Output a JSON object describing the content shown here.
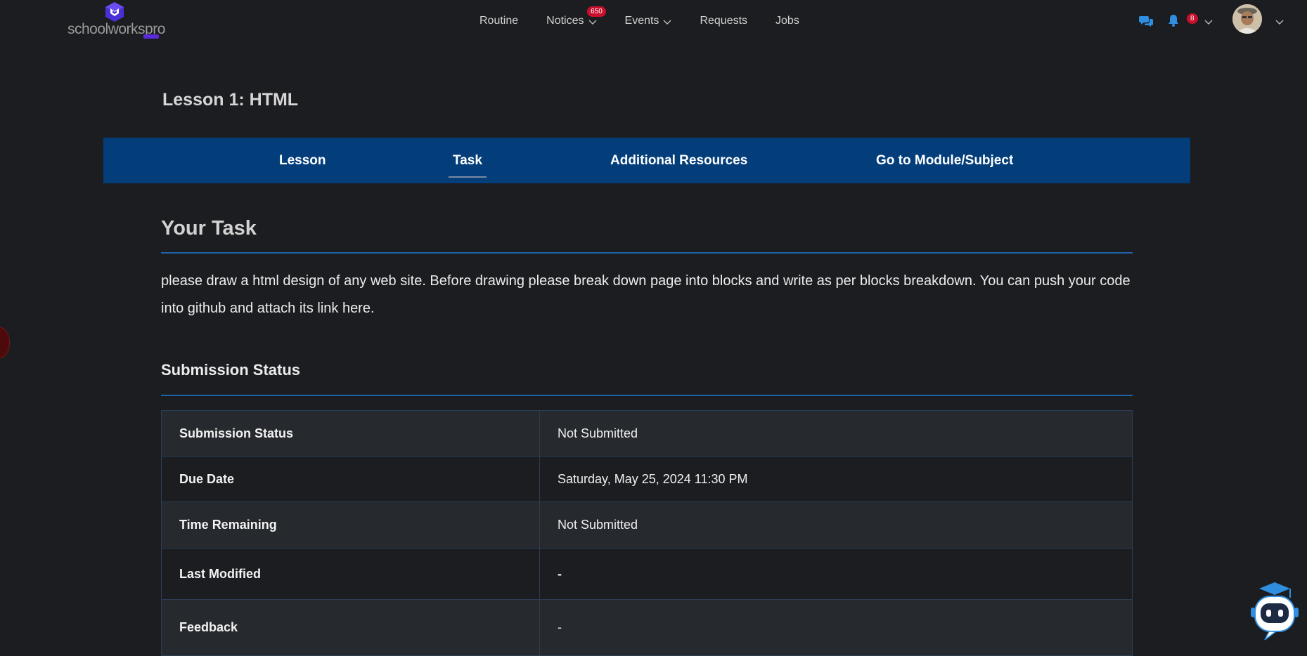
{
  "brand": {
    "name": "schoolworkspro",
    "logo_icon": "cube-logo-icon"
  },
  "nav": {
    "routine": "Routine",
    "notices": "Notices",
    "notices_badge": "650",
    "events": "Events",
    "requests": "Requests",
    "jobs": "Jobs"
  },
  "header_right": {
    "chat_icon": "chat-icon",
    "bell_icon": "bell-icon",
    "bell_badge": "8",
    "avatar": "user-avatar"
  },
  "lesson": {
    "title": "Lesson 1: HTML"
  },
  "tabs": [
    {
      "label": "Lesson",
      "active": false
    },
    {
      "label": "Task",
      "active": true
    },
    {
      "label": "Additional Resources",
      "active": false
    },
    {
      "label": "Go to Module/Subject",
      "active": false
    }
  ],
  "task": {
    "heading": "Your Task",
    "description": "please draw a html design of any web site. Before drawing please break down page into blocks and write as per blocks breakdown. You can push your code into github and attach its link here."
  },
  "submission": {
    "heading": "Submission Status",
    "rows": [
      {
        "label": "Submission Status",
        "value": "Not Submitted"
      },
      {
        "label": "Due Date",
        "value": "Saturday, May 25, 2024 11:30 PM"
      },
      {
        "label": "Time Remaining",
        "value": "Not Submitted"
      },
      {
        "label": "Last Modified",
        "value": "-"
      },
      {
        "label": "Feedback",
        "value": "-"
      }
    ]
  },
  "colors": {
    "background": "#1b1d20",
    "tabbar": "#033e7a",
    "accent_rule": "#1e63a8",
    "badge": "#c8102e",
    "icon_blue": "#2f8ee0"
  }
}
